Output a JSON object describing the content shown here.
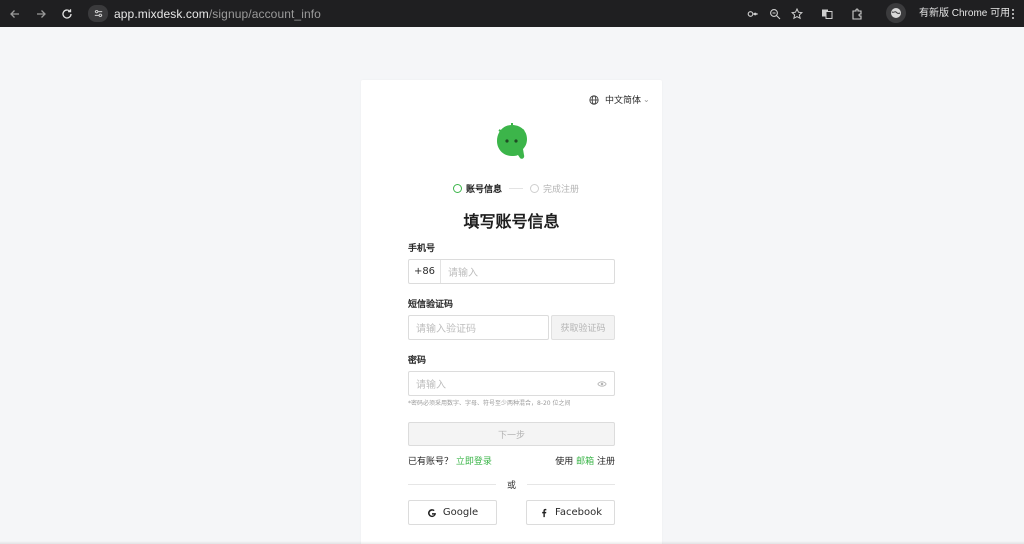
{
  "browser": {
    "url_host": "app.mixdesk.com",
    "url_path": "/signup/account_info",
    "update_text": "有新版 Chrome 可用"
  },
  "language": {
    "label": "中文简体"
  },
  "steps": [
    {
      "label": "账号信息",
      "active": true
    },
    {
      "label": "完成注册",
      "active": false
    }
  ],
  "title": "填写账号信息",
  "phone": {
    "label": "手机号",
    "prefix": "+86",
    "placeholder": "请输入"
  },
  "sms": {
    "label": "短信验证码",
    "placeholder": "请输入验证码",
    "button": "获取验证码"
  },
  "password": {
    "label": "密码",
    "placeholder": "请输入",
    "hint": "*密码必须采用数字、字母、符号至少两种混合，8-20 位之间"
  },
  "next_button": "下一步",
  "login_prompt": {
    "text": "已有账号？",
    "link": "立即登录"
  },
  "email_signup": {
    "prefix": "使用",
    "link": "邮箱",
    "suffix": "注册"
  },
  "or_text": "或",
  "social": {
    "google": "Google",
    "facebook": "Facebook"
  },
  "colors": {
    "brand_green": "#3cb54a",
    "chrome_bg": "#1f1f21",
    "page_bg": "#f5f6f8"
  }
}
